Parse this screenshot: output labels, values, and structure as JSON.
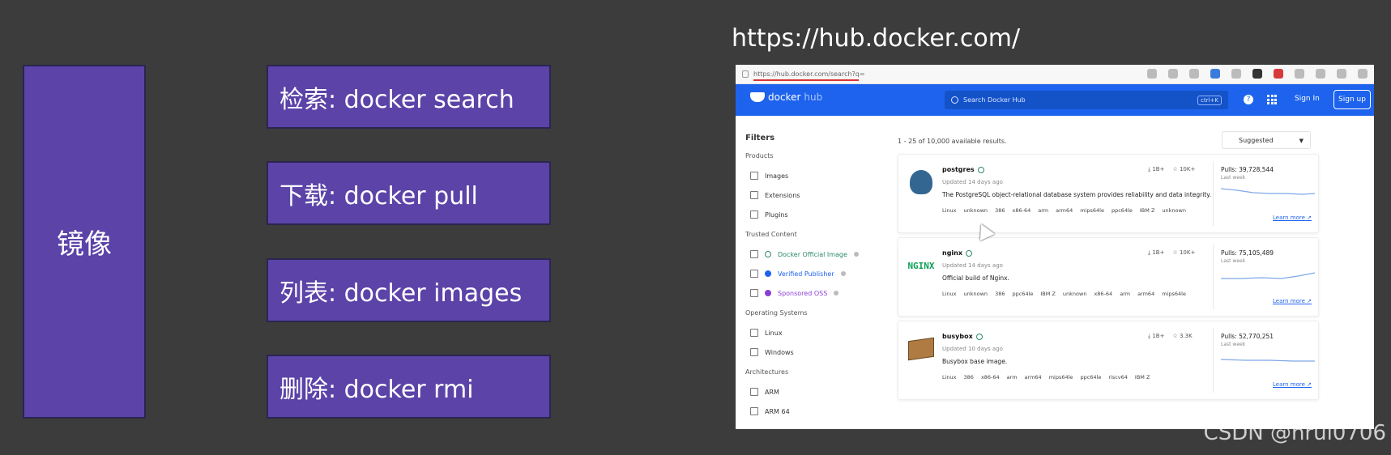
{
  "slide": {
    "main_label": "镜像",
    "commands": [
      {
        "label": "检索: docker search"
      },
      {
        "label": "下载: docker pull"
      },
      {
        "label": "列表: docker images"
      },
      {
        "label": "删除: docker rmi"
      }
    ],
    "url_caption": "https://hub.docker.com/",
    "watermark": "CSDN @hrui0706"
  },
  "browser": {
    "url": "https://hub.docker.com/search?q="
  },
  "dockerhub": {
    "logo_left": "docker",
    "logo_right": "hub",
    "search_placeholder": "Search Docker Hub",
    "search_shortcut": "ctrl+K",
    "help": "?",
    "sign_in": "Sign In",
    "sign_up": "Sign up",
    "filters": {
      "title": "Filters",
      "groups": [
        {
          "title": "Products",
          "items": [
            "Images",
            "Extensions",
            "Plugins"
          ]
        },
        {
          "title": "Trusted Content",
          "items": [
            "Docker Official Image",
            "Verified Publisher",
            "Sponsored OSS"
          ]
        },
        {
          "title": "Operating Systems",
          "items": [
            "Linux",
            "Windows"
          ]
        },
        {
          "title": "Architectures",
          "items": [
            "ARM",
            "ARM 64"
          ]
        }
      ]
    },
    "results_count": "1 - 25 of 10,000 available results.",
    "sort": "Suggested",
    "results": [
      {
        "name": "postgres",
        "updated": "Updated 14 days ago",
        "description": "The PostgreSQL object-relational database system provides reliability and data integrity.",
        "tags": [
          "Linux",
          "unknown",
          "386",
          "x86-64",
          "arm",
          "arm64",
          "mips64le",
          "ppc64le",
          "IBM Z",
          "unknown"
        ],
        "downloads": "1B+",
        "stars": "10K+",
        "pulls": "Pulls: 39,728,544",
        "last_week": "Last week",
        "learn_more": "Learn more"
      },
      {
        "name": "nginx",
        "updated": "Updated 14 days ago",
        "description": "Official build of Nginx.",
        "tags": [
          "Linux",
          "unknown",
          "386",
          "ppc64le",
          "IBM Z",
          "unknown",
          "x86-64",
          "arm",
          "arm64",
          "mips64le"
        ],
        "downloads": "1B+",
        "stars": "10K+",
        "pulls": "Pulls: 75,105,489",
        "last_week": "Last week",
        "learn_more": "Learn more"
      },
      {
        "name": "busybox",
        "updated": "Updated 10 days ago",
        "description": "Busybox base image.",
        "tags": [
          "Linux",
          "386",
          "x86-64",
          "arm",
          "arm64",
          "mips64le",
          "ppc64le",
          "riscv64",
          "IBM Z"
        ],
        "downloads": "1B+",
        "stars": "3.3K",
        "pulls": "Pulls: 52,770,251",
        "last_week": "Last week",
        "learn_more": "Learn more"
      }
    ]
  }
}
